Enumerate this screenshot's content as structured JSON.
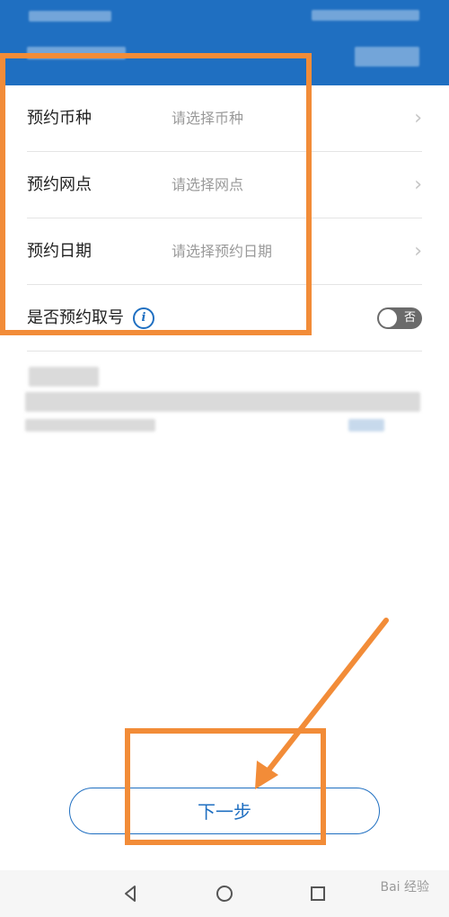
{
  "colors": {
    "accent": "#1f6fc1",
    "annotation": "#f28c38"
  },
  "form": {
    "rows": [
      {
        "label": "预约币种",
        "placeholder": "请选择币种"
      },
      {
        "label": "预约网点",
        "placeholder": "请选择网点"
      },
      {
        "label": "预约日期",
        "placeholder": "请选择预约日期"
      }
    ],
    "queue": {
      "label": "是否预约取号",
      "toggle_label": "否"
    }
  },
  "actions": {
    "next_label": "下一步"
  },
  "icons": {
    "row_arrow": "chevron-right-icon",
    "info": "info-icon",
    "back": "back-triangle-icon",
    "home": "home-circle-icon",
    "recents": "recents-square-icon"
  },
  "watermark": {
    "text": "Bai 经验"
  }
}
